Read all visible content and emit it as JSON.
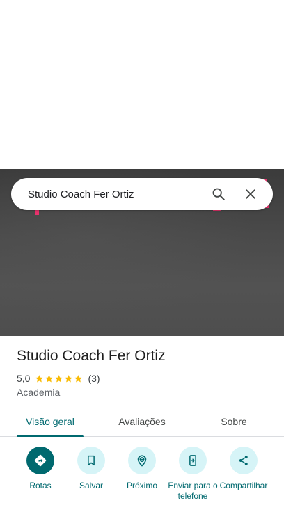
{
  "search": {
    "query": "Studio Coach Fer Ortiz"
  },
  "place": {
    "name": "Studio Coach Fer Ortiz",
    "rating": "5,0",
    "stars": 5,
    "review_count": "(3)",
    "category": "Academia"
  },
  "tabs": [
    {
      "label": "Visão geral",
      "active": true
    },
    {
      "label": "Avaliações",
      "active": false
    },
    {
      "label": "Sobre",
      "active": false
    }
  ],
  "actions": [
    {
      "label": "Rotas",
      "icon": "directions-icon"
    },
    {
      "label": "Salvar",
      "icon": "bookmark-icon"
    },
    {
      "label": "Próximo",
      "icon": "nearby-icon"
    },
    {
      "label": "Enviar para o telefone",
      "icon": "send-to-phone-icon"
    },
    {
      "label": "Compartilhar",
      "icon": "share-icon"
    }
  ],
  "colors": {
    "accent": "#00696f",
    "action_bg": "#d6f4f7",
    "star": "#f9bb04",
    "sign": "#e8336d"
  }
}
